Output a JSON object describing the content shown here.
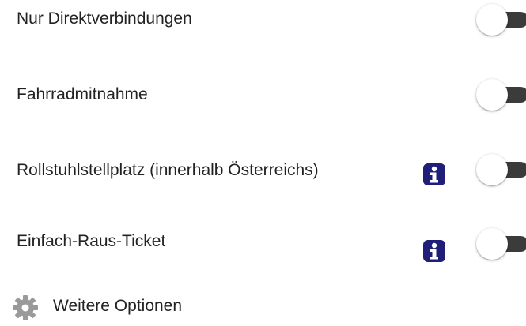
{
  "options": [
    {
      "label": "Nur Direktverbindungen",
      "enabled": false,
      "has_info": false
    },
    {
      "label": "Fahrradmitnahme",
      "enabled": false,
      "has_info": false
    },
    {
      "label": "Rollstuhlstellplatz (innerhalb Österreichs)",
      "enabled": false,
      "has_info": true
    },
    {
      "label": "Einfach-Raus-Ticket",
      "enabled": false,
      "has_info": true
    }
  ],
  "more_options": {
    "label": "Weitere Optionen",
    "icon": "gear-icon"
  },
  "colors": {
    "text": "#222222",
    "toggle_track": "#3b3b3b",
    "toggle_knob": "#ffffff",
    "info_icon": "#1f1f7a",
    "gear_icon": "#9a9a9a"
  }
}
